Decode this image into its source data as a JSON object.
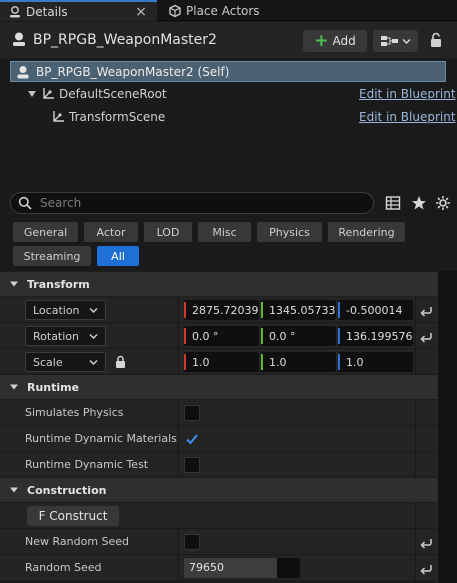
{
  "tabs": [
    {
      "label": "Details",
      "icon": "details-icon",
      "active": true
    },
    {
      "label": "Place Actors",
      "icon": "place-actors-icon",
      "active": false
    }
  ],
  "header": {
    "actor_name": "BP_RPGB_WeaponMaster2",
    "add_label": "Add"
  },
  "tree": {
    "self_label": "BP_RPGB_WeaponMaster2 (Self)",
    "items": [
      {
        "label": "DefaultSceneRoot",
        "link": "Edit in Blueprint"
      },
      {
        "label": "TransformScene",
        "link": "Edit in Blueprint"
      }
    ]
  },
  "search": {
    "placeholder": "Search",
    "value": ""
  },
  "filters": [
    "General",
    "Actor",
    "LOD",
    "Misc",
    "Physics",
    "Rendering",
    "Streaming",
    "All"
  ],
  "active_filter": "All",
  "sections": {
    "transform": "Transform",
    "runtime": "Runtime",
    "construction": "Construction"
  },
  "transform": {
    "location": {
      "label": "Location",
      "x": "2875.720391",
      "y": "1345.057333",
      "z": "-0.500014"
    },
    "rotation": {
      "label": "Rotation",
      "x": "0.0 °",
      "y": "0.0 °",
      "z": "136.199576 °"
    },
    "scale": {
      "label": "Scale",
      "x": "1.0",
      "y": "1.0",
      "z": "1.0"
    }
  },
  "runtime": {
    "simulates_physics": {
      "label": "Simulates Physics",
      "checked": false
    },
    "dynamic_materials": {
      "label": "Runtime Dynamic Materials",
      "checked": true
    },
    "dynamic_test": {
      "label": "Runtime Dynamic Test",
      "checked": false
    }
  },
  "construction": {
    "button_label": "F Construct",
    "new_random_seed": {
      "label": "New Random Seed",
      "checked": false
    },
    "random_seed": {
      "label": "Random Seed",
      "value": "79650",
      "fill_fraction": 0.8
    }
  },
  "colors": {
    "axis_x": "#d23a2e",
    "axis_y": "#5fb832",
    "axis_z": "#2f6fd0",
    "accent": "#1e6fd6",
    "selection": "#4b6274"
  }
}
